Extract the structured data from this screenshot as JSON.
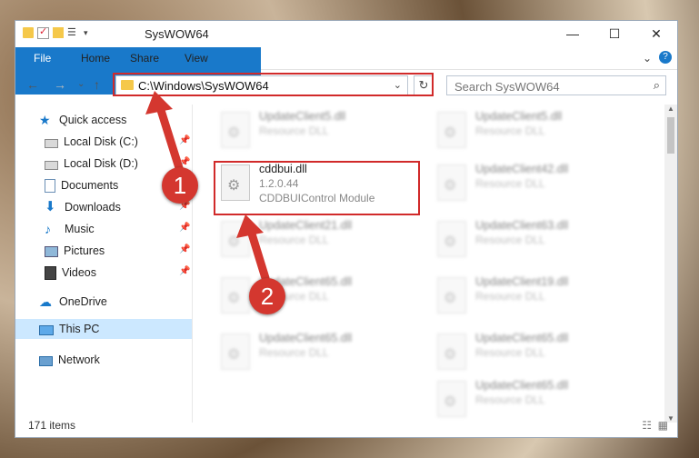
{
  "window": {
    "title": "SysWOW64",
    "controls": {
      "minimize": "—",
      "maximize": "☐",
      "close": "✕"
    }
  },
  "ribbon": {
    "tabs": [
      "File",
      "Home",
      "Share",
      "View"
    ],
    "help": "?",
    "expand": "⌄"
  },
  "nav": {
    "back": "←",
    "forward": "→",
    "recent": "⌄",
    "up": "↑",
    "address": "C:\\Windows\\SysWOW64",
    "refresh": "↻",
    "search_placeholder": "Search SysWOW64",
    "search_icon": "⌕"
  },
  "sidebar": {
    "items": [
      {
        "label": "Quick access",
        "icon": "star-icon",
        "pinned": false
      },
      {
        "label": "Local Disk (C:)",
        "icon": "drive-icon",
        "pinned": true
      },
      {
        "label": "Local Disk (D:)",
        "icon": "drive-icon",
        "pinned": true
      },
      {
        "label": "Documents",
        "icon": "documents-icon",
        "pinned": true
      },
      {
        "label": "Downloads",
        "icon": "downloads-icon",
        "pinned": true
      },
      {
        "label": "Music",
        "icon": "music-icon",
        "pinned": true
      },
      {
        "label": "Pictures",
        "icon": "pictures-icon",
        "pinned": true
      },
      {
        "label": "Videos",
        "icon": "videos-icon",
        "pinned": true
      },
      {
        "label": "OneDrive",
        "icon": "cloud-icon",
        "pinned": false
      },
      {
        "label": "This PC",
        "icon": "computer-icon",
        "pinned": false,
        "selected": true
      },
      {
        "label": "Network",
        "icon": "network-icon",
        "pinned": false
      }
    ]
  },
  "files": {
    "highlighted": {
      "name": "cddbui.dll",
      "version": "1.2.0.44",
      "description": "CDDBUIControl Module"
    },
    "left_column": [
      {
        "name": "UpdateClient5.dll",
        "type": "Resource DLL"
      },
      {
        "name": "UpdateClient21.dll",
        "type": "Resource DLL"
      },
      {
        "name": "UpdateClient65.dll",
        "type": "Resource DLL"
      },
      {
        "name": "UpdateClient65.dll",
        "type": "Resource DLL"
      }
    ],
    "right_column": [
      {
        "name": "UpdateClient5.dll",
        "type": "Resource DLL"
      },
      {
        "name": "UpdateClient42.dll",
        "type": "Resource DLL"
      },
      {
        "name": "UpdateClient63.dll",
        "type": "Resource DLL"
      },
      {
        "name": "UpdateClient19.dll",
        "type": "Resource DLL"
      },
      {
        "name": "UpdateClient65.dll",
        "type": "Resource DLL"
      },
      {
        "name": "UpdateClient65.dll",
        "type": "Resource DLL"
      }
    ]
  },
  "status": {
    "count": "171 items"
  },
  "annotations": {
    "step1": "1",
    "step2": "2"
  },
  "colors": {
    "accent": "#1979ca",
    "highlight": "#d12a2a",
    "badge": "#d4372f"
  }
}
